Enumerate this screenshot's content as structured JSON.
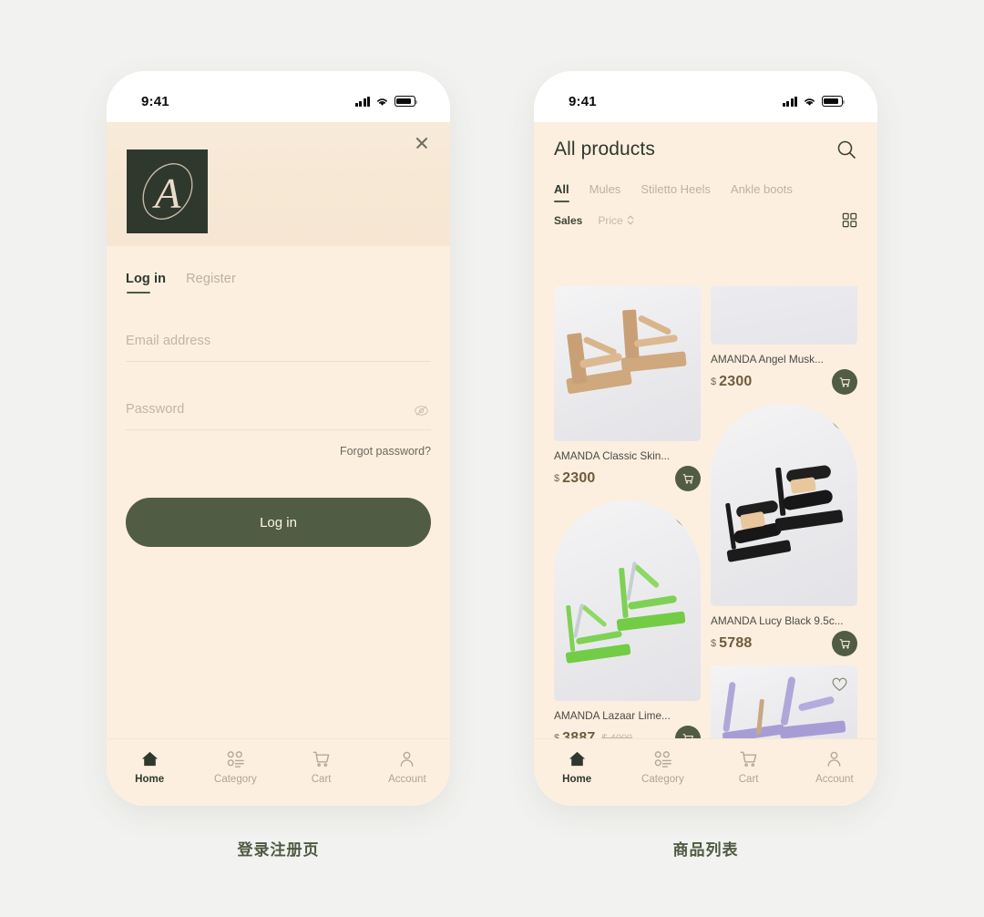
{
  "status_bar": {
    "time": "9:41",
    "signal_icon": "signal-bars-icon",
    "wifi_icon": "wifi-icon",
    "battery_icon": "battery-icon"
  },
  "login_screen": {
    "close_label": "×",
    "brand_letter": "A",
    "tabs": [
      {
        "label": "Log in",
        "active": true
      },
      {
        "label": "Register",
        "active": false
      }
    ],
    "email_placeholder": "Email address",
    "password_placeholder": "Password",
    "eye_icon": "eye-off-icon",
    "forgot_label": "Forgot password?",
    "submit_label": "Log in"
  },
  "product_screen": {
    "title": "All products",
    "search_icon": "search-icon",
    "category_tabs": [
      {
        "label": "All",
        "active": true
      },
      {
        "label": "Mules",
        "active": false
      },
      {
        "label": "Stiletto Heels",
        "active": false
      },
      {
        "label": "Ankle boots",
        "active": false
      }
    ],
    "sort": [
      {
        "label": "Sales",
        "active": true,
        "has_arrows": false
      },
      {
        "label": "Price",
        "active": false,
        "has_arrows": true
      }
    ],
    "grid_toggle_icon": "grid-view-icon",
    "products_left": [
      {
        "name": "AMANDA Classic Skin...",
        "currency": "$",
        "price": "2300",
        "old_price": "",
        "cart_icon": "cart-icon",
        "heart_icon": ""
      },
      {
        "name": "AMANDA Lazaar Lime...",
        "currency": "$",
        "price": "3887",
        "old_price": "$ 4000",
        "cart_icon": "cart-icon",
        "heart_icon": "heart-outline-icon"
      }
    ],
    "products_right": [
      {
        "name": "AMANDA Angel Musk...",
        "currency": "$",
        "price": "2300",
        "old_price": "",
        "cart_icon": "cart-icon",
        "heart_icon": ""
      },
      {
        "name": "AMANDA Lucy Black 9.5c...",
        "currency": "$",
        "price": "5788",
        "old_price": "",
        "cart_icon": "cart-icon",
        "heart_icon": "heart-outline-icon"
      }
    ]
  },
  "tab_bar": [
    {
      "label": "Home",
      "icon": "home-icon",
      "active": true
    },
    {
      "label": "Category",
      "icon": "category-grid-icon",
      "active": false
    },
    {
      "label": "Cart",
      "icon": "cart-icon",
      "active": false
    },
    {
      "label": "Account",
      "icon": "account-person-icon",
      "active": false
    }
  ],
  "captions": {
    "left": "登录注册页",
    "right": "商品列表"
  },
  "colors": {
    "page_background": "#f2f2f0",
    "app_background": "#fcefe0",
    "brand_dark": "#2f382c",
    "accent_green": "#515c44",
    "price_brown": "#6f5c3e",
    "muted_text": "#bcb1a3"
  }
}
